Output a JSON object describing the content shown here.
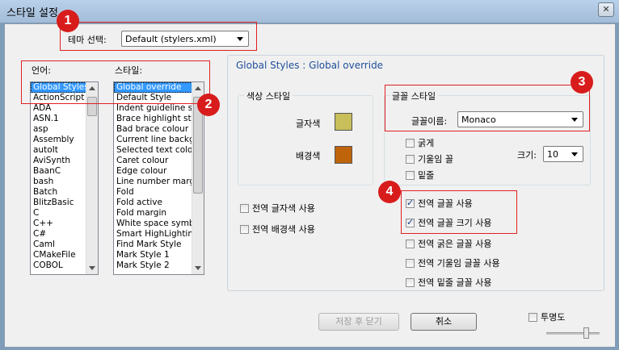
{
  "window": {
    "title": "스타일 설정",
    "close_glyph": "✕"
  },
  "theme": {
    "label": "테마 선택:",
    "selected": "Default (stylers.xml)"
  },
  "language": {
    "label": "언어:",
    "items": [
      "Global Styles",
      "ActionScript",
      "ADA",
      "ASN.1",
      "asp",
      "Assembly",
      "autoIt",
      "AviSynth",
      "BaanC",
      "bash",
      "Batch",
      "BlitzBasic",
      "C",
      "C++",
      "C#",
      "Caml",
      "CMakeFile",
      "COBOL"
    ],
    "selected_index": 0
  },
  "style": {
    "label": "스타일:",
    "items": [
      "Global override",
      "Default Style",
      "Indent guideline sty",
      "Brace highlight style",
      "Bad brace colour",
      "Current line backgr",
      "Selected text colou",
      "Caret colour",
      "Edge colour",
      "Line number margin",
      "Fold",
      "Fold active",
      "Fold margin",
      "White space symbo",
      "Smart HighLighting",
      "Find Mark Style",
      "Mark Style 1",
      "Mark Style 2"
    ],
    "selected_index": 0
  },
  "heading": "Global Styles : Global override",
  "color_style": {
    "legend": "색상 스타일",
    "fg_label": "글자색",
    "bg_label": "배경색",
    "fg_color": "#c8be5a",
    "bg_color": "#c0640c"
  },
  "font_style": {
    "legend": "글꼴 스타일",
    "name_label": "글꼴이름:",
    "name_value": "Monaco",
    "bold": "굵게",
    "italic": "기울임 꼴",
    "underline": "밑줄",
    "size_label": "크기:",
    "size_value": "10"
  },
  "global": {
    "fg": "전역 글자색 사용",
    "bg": "전역 배경색 사용",
    "font": "전역 글꼴 사용",
    "font_size": "전역 글꼴 크기 사용",
    "bold": "전역 굵은 글꼴 사용",
    "italic": "전역 기울임 글꼴 사용",
    "underline": "전역 밑줄 글꼴 사용"
  },
  "buttons": {
    "save": "저장 후 닫기",
    "cancel": "취소"
  },
  "transparency": {
    "label": "투명도"
  },
  "badges": [
    "1",
    "2",
    "3",
    "4"
  ],
  "annotation_color": "#e02020"
}
